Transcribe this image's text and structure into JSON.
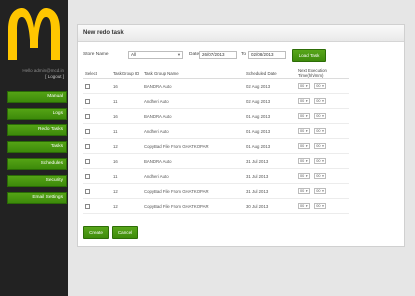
{
  "user": {
    "name": "Hello admin@mcd.in",
    "logout": "[ Logout ]"
  },
  "nav": [
    {
      "label": "Manual",
      "name": "nav-manual"
    },
    {
      "label": "Logs",
      "name": "nav-logs"
    },
    {
      "label": "Redo Tasks",
      "name": "nav-redo-tasks"
    },
    {
      "label": "Tasks",
      "name": "nav-tasks"
    },
    {
      "label": "Schedules",
      "name": "nav-schedules"
    },
    {
      "label": "Security",
      "name": "nav-security"
    },
    {
      "label": "Email Settings",
      "name": "nav-email-settings"
    }
  ],
  "panel": {
    "title": "New redo task",
    "store_label": "Store Name",
    "store_value": "All",
    "date_label": "Date",
    "date_from": "26/07/2013",
    "to_label": "To",
    "date_to": "02/08/2013",
    "load_button": "Load Task Group"
  },
  "table": {
    "headers": [
      "Select",
      "TaskGroup ID",
      "Task Group Name",
      "Scheduled Date",
      "Next Execution Time(hh/mm)"
    ],
    "rows": [
      {
        "id": "16",
        "name": "BANDRA Auto",
        "date": "02 Aug 2013",
        "hh": "00",
        "mm": "00"
      },
      {
        "id": "11",
        "name": "Andheri Auto",
        "date": "02 Aug 2013",
        "hh": "00",
        "mm": "00"
      },
      {
        "id": "16",
        "name": "BANDRA Auto",
        "date": "01 Aug 2013",
        "hh": "00",
        "mm": "00"
      },
      {
        "id": "11",
        "name": "Andheri Auto",
        "date": "01 Aug 2013",
        "hh": "00",
        "mm": "00"
      },
      {
        "id": "12",
        "name": "CopyBad File From GHATKOPAR",
        "date": "01 Aug 2013",
        "hh": "00",
        "mm": "00"
      },
      {
        "id": "16",
        "name": "BANDRA Auto",
        "date": "31 Jul 2013",
        "hh": "00",
        "mm": "00"
      },
      {
        "id": "11",
        "name": "Andheri Auto",
        "date": "31 Jul 2013",
        "hh": "00",
        "mm": "00"
      },
      {
        "id": "12",
        "name": "CopyBad File From GHATKOPAR",
        "date": "31 Jul 2013",
        "hh": "00",
        "mm": "00"
      },
      {
        "id": "12",
        "name": "CopyBad File From GHATKOPAR",
        "date": "30 Jul 2013",
        "hh": "00",
        "mm": "00"
      }
    ]
  },
  "actions": {
    "create": "Create",
    "cancel": "Cancel"
  },
  "colors": {
    "sidebar": "#222222",
    "accent_green": "#4a9a12",
    "logo_yellow": "#ffc600"
  }
}
